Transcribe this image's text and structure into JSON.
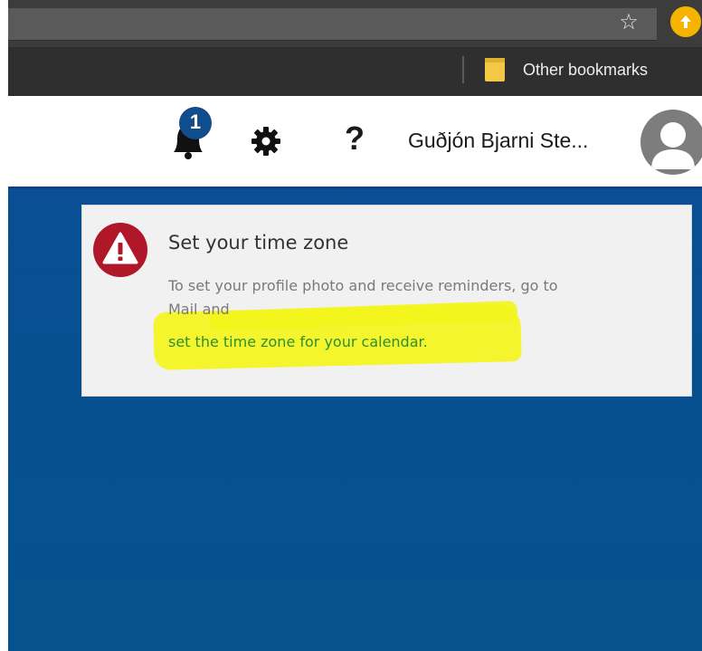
{
  "browser": {
    "star_icon": "star-outline-icon",
    "extension_icon": "arrow-up-circle-icon",
    "extension_color": "#f4b400",
    "bookmarks": {
      "folder_icon": "folder-icon",
      "folder_label": "Other bookmarks"
    }
  },
  "header": {
    "notifications": {
      "icon": "bell-icon",
      "count": "1",
      "badge_color": "#0f4d8c"
    },
    "settings_icon": "gear-icon",
    "help_label": "?",
    "user_name": "Guðjón Bjarni Ste...",
    "avatar_icon": "user-silhouette-icon"
  },
  "notice": {
    "icon": "warning-triangle-icon",
    "icon_color": "#b0182a",
    "title": "Set your time zone",
    "body_line1": "To set your profile photo and receive reminders, go to",
    "body_line2": "Mail and",
    "link_text": "set the time zone for your calendar.",
    "link_color": "#2f8f2f",
    "highlight_color": "#f4f51c"
  },
  "theme": {
    "content_background": "#06508f",
    "chrome_dark": "#3c3c3c"
  }
}
